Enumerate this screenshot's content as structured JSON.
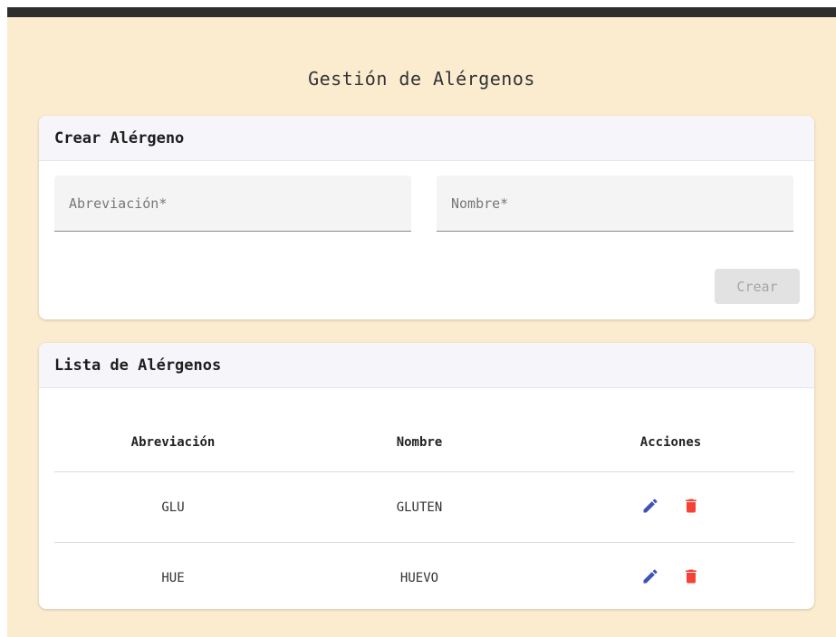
{
  "page_title": "Gestión de Alérgenos",
  "create_card": {
    "title": "Crear Alérgeno",
    "abbr_placeholder": "Abreviación*",
    "name_placeholder": "Nombre*",
    "create_label": "Crear"
  },
  "list_card": {
    "title": "Lista de Alérgenos",
    "columns": [
      "Abreviación",
      "Nombre",
      "Acciones"
    ],
    "rows": [
      {
        "abbr": "GLU",
        "name": "GLUTEN"
      },
      {
        "abbr": "HUE",
        "name": "HUEVO"
      }
    ]
  },
  "icons": {
    "edit": "pencil-icon",
    "delete": "trash-icon"
  },
  "colors": {
    "background": "#fbecd0",
    "edit": "#3f51b5",
    "delete": "#f44336",
    "topbar": "#2e2e2e"
  }
}
